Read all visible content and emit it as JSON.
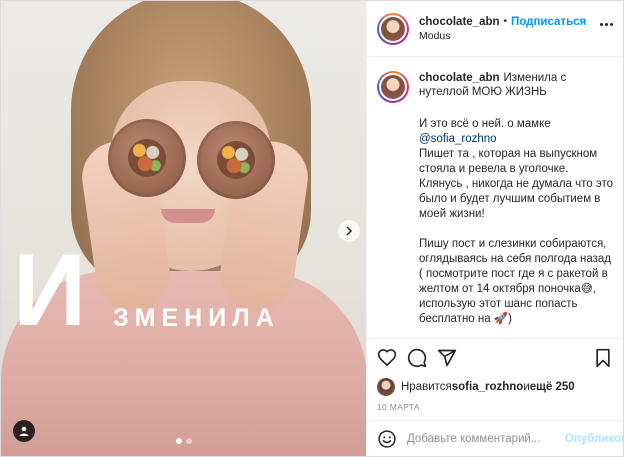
{
  "header": {
    "username": "chocolate_abn",
    "bullet": "•",
    "follow_label": "Подписаться",
    "location": "Modus"
  },
  "caption": {
    "username": "chocolate_abn",
    "first_line": "Изменила с нутеллой МОЮ ЖИЗНЬ",
    "body_start": "И это всё о ней. о мамке\n",
    "mention": "@sofia_rozhno",
    "body_end": "\nПишет та , которая на выпускном стояла и ревела в уголочке. Клянусь , никогда не думала что это было и будет лучшим событием в моей жизни!\n\nПишу пост и слезинки собираются, оглядываясь на себя полгода назад ( посмотрите пост где я с ракетой в желтом от 14 октября поночка😅, использую этот шанс попасть бесплатно на 🚀)"
  },
  "photo": {
    "big_letter": "И",
    "overlay_word": "ЗМЕНИЛА",
    "carousel": {
      "slides": 2,
      "active": 1
    }
  },
  "likes": {
    "prefix": "Нравится ",
    "liker": "sofia_rozhno",
    "middle": " и ",
    "count": "ещё 250"
  },
  "date": "10 марта",
  "comment": {
    "placeholder": "Добавьте комментарий...",
    "publish_label": "Опубликовать"
  },
  "icons": {
    "like": "heart-icon",
    "comment": "comment-icon",
    "share": "share-icon",
    "save": "bookmark-icon",
    "emoji": "emoji-icon",
    "more": "more-icon",
    "next": "chevron-right-icon",
    "tag": "user-tag-icon"
  },
  "colors": {
    "follow": "#0095f6",
    "mention": "#00376b",
    "publish_disabled": "#b2dffc",
    "muted": "#8e8e8e"
  }
}
